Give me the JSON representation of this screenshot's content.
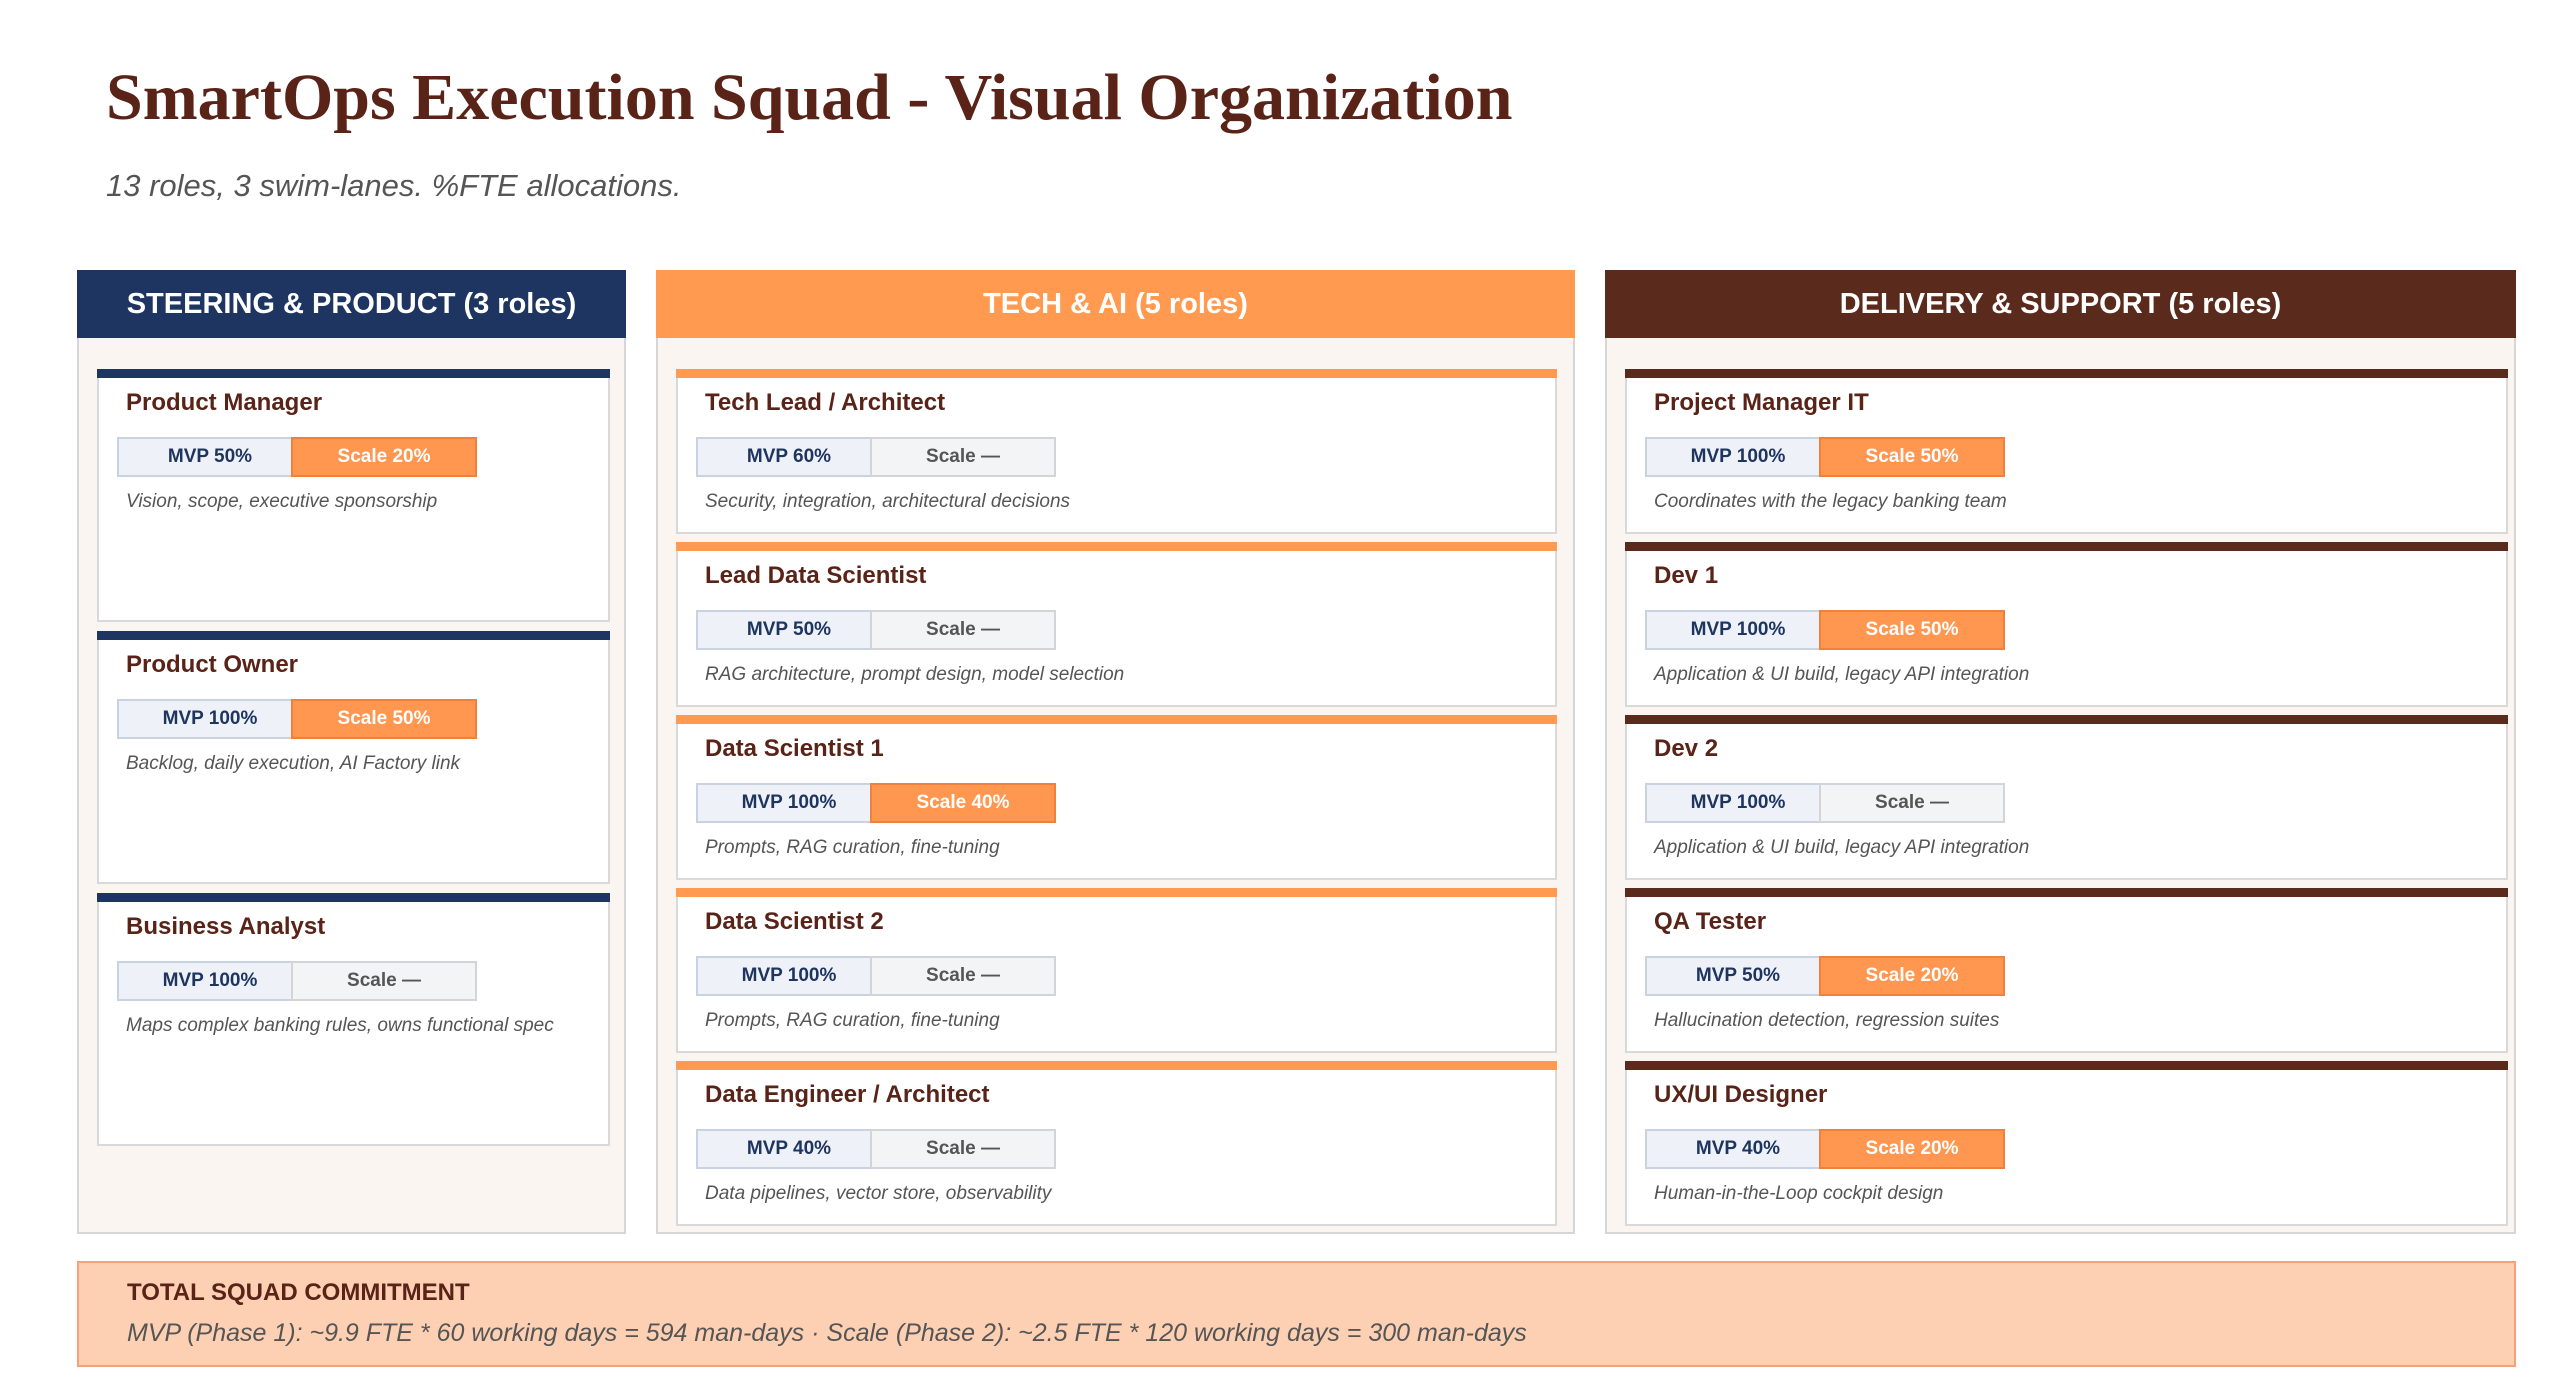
{
  "header": {
    "title": "SmartOps Execution Squad - Visual Organization",
    "subtitle": "13 roles, 3 swim-lanes. %FTE allocations."
  },
  "colors": {
    "title": "#5a2318",
    "steering": "#1e3461",
    "tech": "#ff9a50",
    "delivery": "#5a2a1c",
    "scale_active": "#ff9750",
    "total_background": "#fdd0b3"
  },
  "lanes": [
    {
      "label": "STEERING & PRODUCT  (3 roles)",
      "roles": [
        {
          "title": "Product Manager",
          "mvp": "MVP 50%",
          "scale": "Scale 20%",
          "desc": "Vision, scope, executive sponsorship"
        },
        {
          "title": "Product Owner",
          "mvp": "MVP 100%",
          "scale": "Scale 50%",
          "desc": "Backlog, daily execution, AI Factory link"
        },
        {
          "title": "Business Analyst",
          "mvp": "MVP 100%",
          "scale": "Scale —",
          "desc": "Maps complex banking rules, owns functional spec"
        }
      ]
    },
    {
      "label": "TECH & AI  (5 roles)",
      "roles": [
        {
          "title": "Tech Lead / Architect",
          "mvp": "MVP 60%",
          "scale": "Scale —",
          "desc": "Security, integration, architectural decisions"
        },
        {
          "title": "Lead Data Scientist",
          "mvp": "MVP 50%",
          "scale": "Scale —",
          "desc": "RAG architecture, prompt design, model selection"
        },
        {
          "title": "Data Scientist 1",
          "mvp": "MVP 100%",
          "scale": "Scale 40%",
          "desc": "Prompts, RAG curation, fine-tuning"
        },
        {
          "title": "Data Scientist 2",
          "mvp": "MVP 100%",
          "scale": "Scale —",
          "desc": "Prompts, RAG curation, fine-tuning"
        },
        {
          "title": "Data Engineer / Architect",
          "mvp": "MVP 40%",
          "scale": "Scale —",
          "desc": "Data pipelines, vector store, observability"
        }
      ]
    },
    {
      "label": "DELIVERY & SUPPORT  (5 roles)",
      "roles": [
        {
          "title": "Project Manager IT",
          "mvp": "MVP 100%",
          "scale": "Scale 50%",
          "desc": "Coordinates with the legacy banking team"
        },
        {
          "title": "Dev 1",
          "mvp": "MVP 100%",
          "scale": "Scale 50%",
          "desc": "Application & UI build, legacy API integration"
        },
        {
          "title": "Dev 2",
          "mvp": "MVP 100%",
          "scale": "Scale —",
          "desc": "Application & UI build, legacy API integration"
        },
        {
          "title": "QA Tester",
          "mvp": "MVP 50%",
          "scale": "Scale 20%",
          "desc": "Hallucination detection, regression suites"
        },
        {
          "title": "UX/UI Designer",
          "mvp": "MVP 40%",
          "scale": "Scale 20%",
          "desc": "Human-in-the-Loop cockpit design"
        }
      ]
    }
  ],
  "total": {
    "label": "TOTAL SQUAD COMMITMENT",
    "text": "MVP (Phase 1): ~9.9 FTE * 60 working days = 594 man-days  ·  Scale (Phase 2): ~2.5 FTE * 120 working days = 300 man-days"
  }
}
